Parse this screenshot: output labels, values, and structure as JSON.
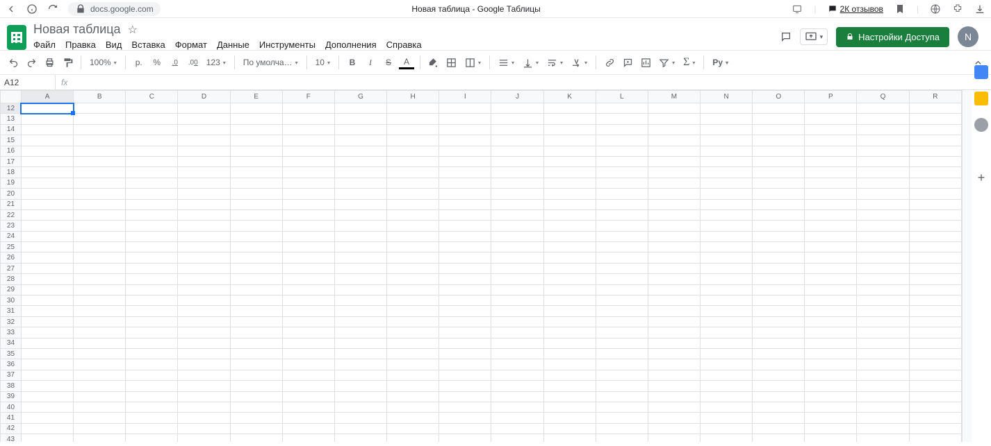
{
  "browser": {
    "url": "docs.google.com",
    "page_title": "Новая таблица - Google Таблицы",
    "reviews": "2К отзывов"
  },
  "doc": {
    "title": "Новая таблица",
    "avatar_initial": "N",
    "share_label": "Настройки Доступа"
  },
  "menus": [
    "Файл",
    "Правка",
    "Вид",
    "Вставка",
    "Формат",
    "Данные",
    "Инструменты",
    "Дополнения",
    "Справка"
  ],
  "toolbar": {
    "zoom": "100%",
    "currency": "р.",
    "percent": "%",
    "dec_dec": ".0",
    "dec_inc": ".00",
    "num_format": "123",
    "font": "По умолча…",
    "font_size": "10",
    "bold": "B",
    "italic": "I",
    "strike": "S",
    "textcolor": "A",
    "input_lang": "Ру"
  },
  "namebox": "A12",
  "grid": {
    "columns": [
      "A",
      "B",
      "C",
      "D",
      "E",
      "F",
      "G",
      "H",
      "I",
      "J",
      "K",
      "L",
      "M",
      "N",
      "O",
      "P",
      "Q",
      "R"
    ],
    "row_start": 12,
    "row_end": 43,
    "selected_cell": {
      "col": "A",
      "row": 12
    }
  }
}
